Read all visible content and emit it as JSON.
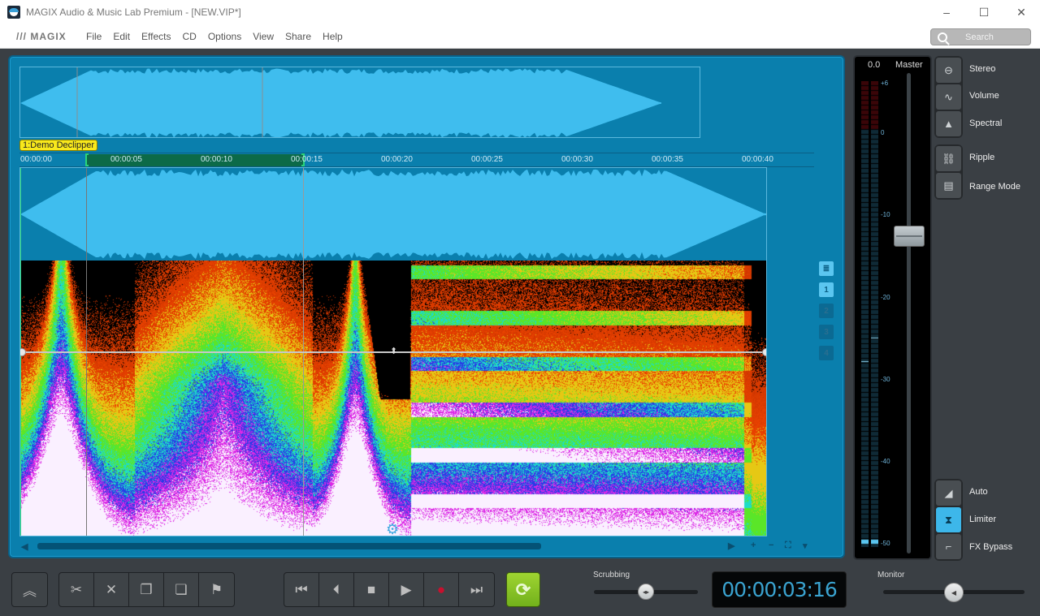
{
  "window": {
    "title": "MAGIX Audio & Music Lab Premium - [NEW.VIP*]",
    "minimize": "–",
    "maximize": "☐",
    "close": "✕"
  },
  "menubar": {
    "logo": "/// MAGIX",
    "items": [
      "File",
      "Edit",
      "Effects",
      "CD",
      "Options",
      "View",
      "Share",
      "Help"
    ],
    "search_placeholder": "Search"
  },
  "track": {
    "clip_label": "1:Demo Declipper",
    "ruler_ticks": [
      "00:00:00",
      "00:00:05",
      "00:00:10",
      "00:00:15",
      "00:00:20",
      "00:00:25",
      "00:00:30",
      "00:00:35",
      "00:00:40"
    ],
    "selection_range": {
      "start_seconds": 3.7,
      "end_seconds": 15.6
    },
    "side_buttons": [
      {
        "icon": "list-icon",
        "label": "≣",
        "active": true
      },
      {
        "icon": "",
        "label": "1",
        "active": true
      },
      {
        "icon": "",
        "label": "2",
        "active": false
      },
      {
        "icon": "",
        "label": "3",
        "active": false
      },
      {
        "icon": "",
        "label": "4",
        "active": false
      }
    ],
    "scroll_controls": [
      "▶",
      "+",
      "−",
      "⛶",
      "▾"
    ],
    "scroll_left": "◀"
  },
  "meter": {
    "value": "0.0",
    "label": "Master",
    "scale": [
      "+6",
      "0",
      "-10",
      "-20",
      "-30",
      "-40",
      "-50"
    ],
    "fader_db": -12
  },
  "view_buttons": [
    {
      "label": "Stereo",
      "icon": "stereo-icon",
      "glyph": "⊖",
      "active": false
    },
    {
      "label": "Volume",
      "icon": "volume-curve-icon",
      "glyph": "∿",
      "active": false
    },
    {
      "label": "Spectral",
      "icon": "spectral-icon",
      "glyph": "▲",
      "active": false
    }
  ],
  "mode_buttons": [
    {
      "label": "Ripple",
      "icon": "chain-link-icon",
      "glyph": "⛓",
      "active": false
    },
    {
      "label": "Range Mode",
      "icon": "range-mode-icon",
      "glyph": "▤",
      "active": false
    }
  ],
  "output_buttons": [
    {
      "label": "Auto",
      "icon": "auto-ramp-icon",
      "glyph": "◢",
      "active": false
    },
    {
      "label": "Limiter",
      "icon": "limiter-icon",
      "glyph": "⧗",
      "active": true
    },
    {
      "label": "FX Bypass",
      "icon": "fx-bypass-icon",
      "glyph": "⌐",
      "active": false
    }
  ],
  "transport": {
    "collapse": {
      "icon": "double-chevron-up-icon",
      "glyph": "︽"
    },
    "edit_tools": [
      {
        "icon": "scissors-icon",
        "glyph": "✂"
      },
      {
        "icon": "delete-x-icon",
        "glyph": "✕"
      },
      {
        "icon": "copy-icon",
        "glyph": "❐"
      },
      {
        "icon": "paste-icon",
        "glyph": "❏"
      },
      {
        "icon": "marker-flag-icon",
        "glyph": "⚑"
      }
    ],
    "playback": [
      {
        "icon": "go-to-start-icon",
        "glyph": "⏮"
      },
      {
        "icon": "previous-marker-icon",
        "glyph": "⏴"
      },
      {
        "icon": "stop-icon",
        "glyph": "■"
      },
      {
        "icon": "play-icon",
        "glyph": "▶"
      },
      {
        "icon": "record-icon",
        "glyph": "●"
      },
      {
        "icon": "go-to-end-icon",
        "glyph": "⏭"
      }
    ],
    "loop": {
      "icon": "loop-icon",
      "glyph": "⟳",
      "active": true
    },
    "scrubbing_label": "Scrubbing",
    "scrubbing_value": 0.5,
    "time": "00:00:03:16",
    "monitor_label": "Monitor",
    "monitor_value": 0.5
  },
  "colors": {
    "panel_blue": "#0a7fad",
    "waveform": "#3fbdee",
    "clip_label": "#f8e81c",
    "loop_green": "#8cc63f",
    "record_red": "#c8102e",
    "selection_green": "#0c6a48"
  }
}
